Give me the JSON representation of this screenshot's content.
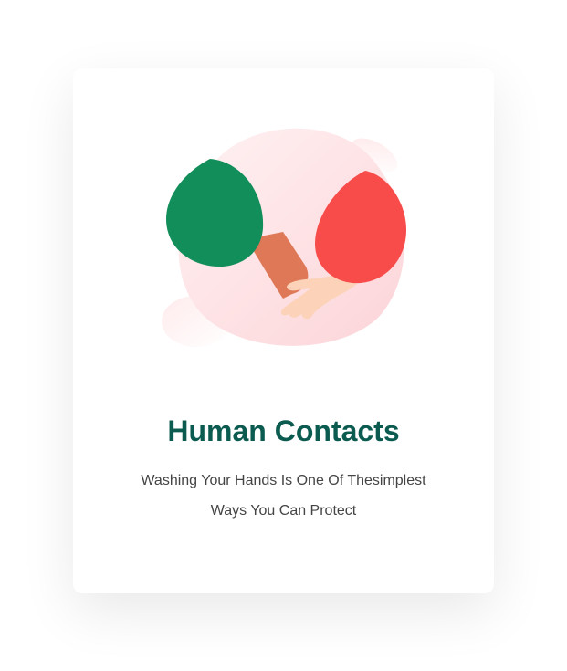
{
  "card": {
    "title": "Human Contacts",
    "description_line1": "Washing Your Hands Is One Of Thesimplest",
    "description_line2": "Ways You Can Protect"
  },
  "illustration": {
    "icon": "handshake-icon",
    "colors": {
      "blob": "#fde1e3",
      "left_sleeve": "#128e5a",
      "right_sleeve": "#f84c4b",
      "dark_skin": "#de7857",
      "light_skin": "#fcd3b9"
    }
  },
  "colors": {
    "title": "#0c5b50",
    "text": "#444444",
    "card_bg": "#ffffff"
  }
}
